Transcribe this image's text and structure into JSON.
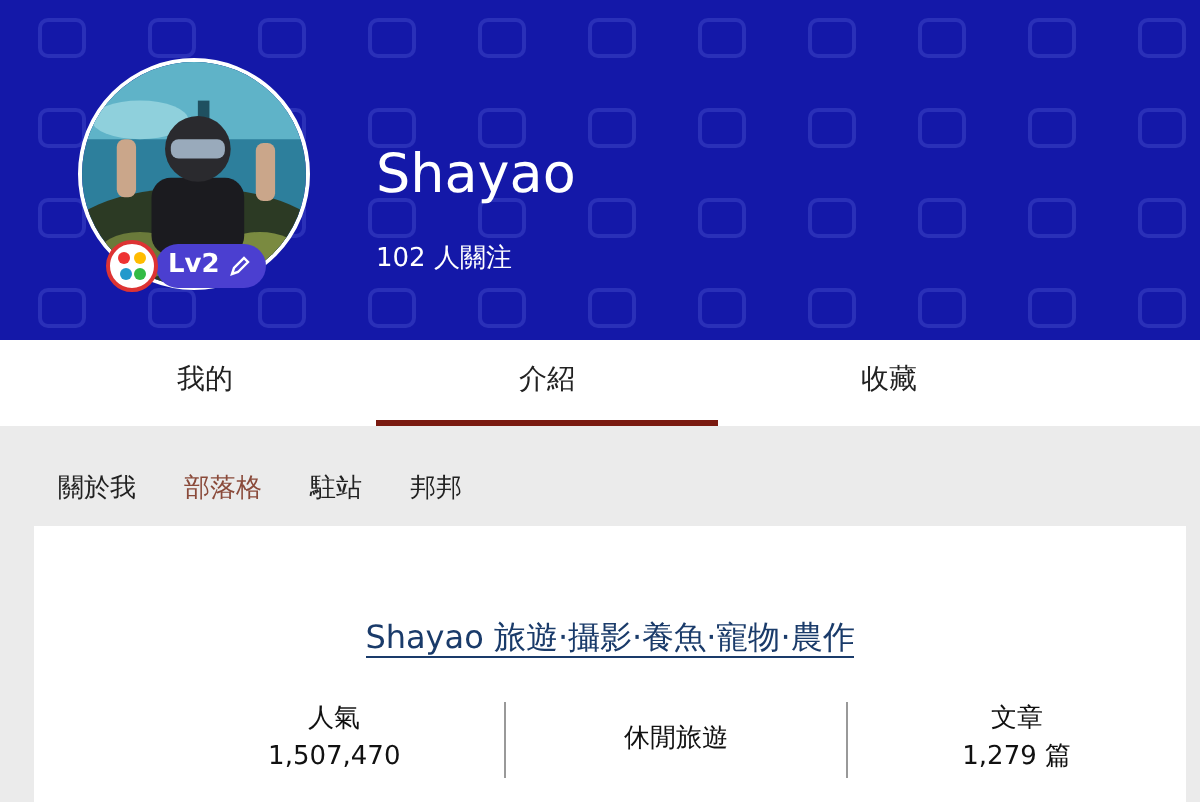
{
  "profile": {
    "name": "Shayao",
    "followers": "102 人關注",
    "level": "Lv2"
  },
  "tabs": [
    {
      "label": "我的",
      "selected": false
    },
    {
      "label": "介紹",
      "selected": true
    },
    {
      "label": "收藏",
      "selected": false
    }
  ],
  "sub_tabs": [
    {
      "label": "關於我",
      "selected": false
    },
    {
      "label": "部落格",
      "selected": true
    },
    {
      "label": "駐站",
      "selected": false
    },
    {
      "label": "邦邦",
      "selected": false
    }
  ],
  "blog": {
    "title": "Shayao 旅遊·攝影·養魚·寵物·農作",
    "stats": [
      {
        "kind": "stat",
        "label": "人氣",
        "value": "1,507,470"
      },
      {
        "kind": "category",
        "label": "休閒旅遊"
      },
      {
        "kind": "stat",
        "label": "文章",
        "value": "1,279 篇"
      }
    ]
  }
}
